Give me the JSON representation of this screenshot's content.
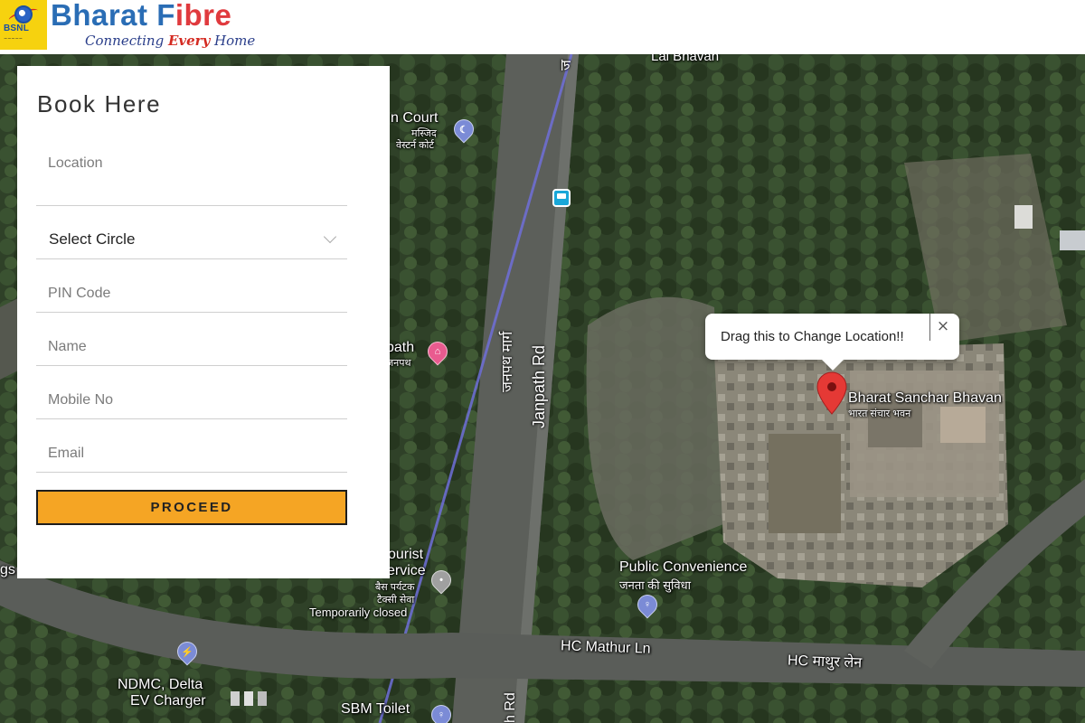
{
  "header": {
    "operator_logo_text": "BSNL",
    "brand_name_part1": "Bharat F",
    "brand_name_part2": "ibre",
    "tagline_part1": "Connecting ",
    "tagline_part2": "Every",
    "tagline_part3": " Home"
  },
  "booking": {
    "title": "Book Here",
    "location_placeholder": "Location",
    "circle_selected": "Select Circle",
    "pin_placeholder": "PIN Code",
    "name_placeholder": "Name",
    "mobile_placeholder": "Mobile No",
    "email_placeholder": "Email",
    "proceed_label": "PROCEED"
  },
  "map": {
    "info_window_text": "Drag this to Change Location!!",
    "info_window_close": "×",
    "marker_title": "Bharat Sanchar Bhavan",
    "marker_title_hindi": "भारत संचार भवन",
    "labels": {
      "lal_bhavan": "Lal Bhavan",
      "court": "n Court",
      "court_hi1": "मस्जिद",
      "court_hi2": "वेस्टर्न कोर्ट",
      "path": "path",
      "path_hi": "जनपथ",
      "tourist1": "ourist",
      "tourist2": "ervice",
      "tourist_hi1": "बैस पर्यटक",
      "tourist_hi2": "टैक्सी सेवा",
      "tourist_status": "Temporarily closed",
      "public_conv": "Public Convenience",
      "public_conv_hi": "जनता की सुविधा",
      "hc_mathur": "HC Mathur Ln",
      "hc_mathur_hi": "HC माथुर लेन",
      "ndmc1": "NDMC, Delta",
      "ndmc2": "EV Charger",
      "sbm": "SBM Toilet",
      "gs": "gs",
      "janpath_rd": "Janpath Rd",
      "janpath_marg": "जनपथ मार्ग",
      "h_rd": "h Rd",
      "top_road": "ज"
    },
    "colors": {
      "marker": "#e53935",
      "proceed": "#f5a524",
      "restaurant_pin": "#e95b8f",
      "poi_pin": "#a0a0a0",
      "amenity_pin": "#7b8bd6",
      "bus_stop": "#19a7d8"
    }
  }
}
